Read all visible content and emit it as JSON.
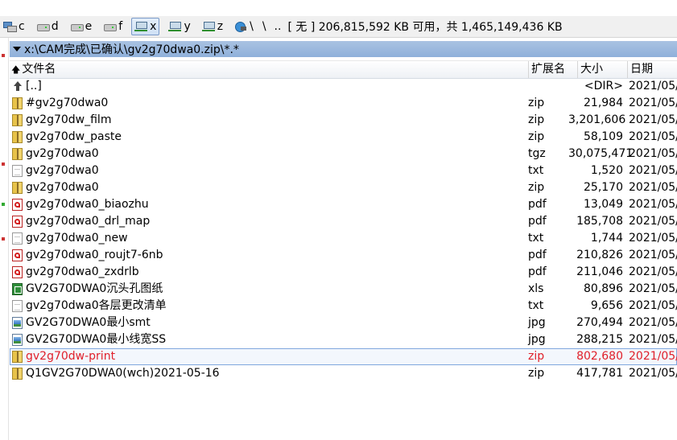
{
  "drivebar": {
    "drives": [
      {
        "label": "c",
        "icon": "system-drive-icon",
        "active": false
      },
      {
        "label": "d",
        "icon": "hard-drive-icon",
        "active": false
      },
      {
        "label": "e",
        "icon": "hard-drive-icon",
        "active": false
      },
      {
        "label": "f",
        "icon": "hard-drive-icon",
        "active": false
      },
      {
        "label": "x",
        "icon": "network-drive-icon",
        "active": true
      },
      {
        "label": "y",
        "icon": "network-drive-icon",
        "active": false
      },
      {
        "label": "z",
        "icon": "network-drive-icon",
        "active": false
      },
      {
        "label": "\\",
        "icon": "network-globe-icon",
        "active": false
      }
    ],
    "root": "\\",
    "up": "..",
    "info": "[ 无 ]  206,815,592 KB 可用，共 1,465,149,436 KB"
  },
  "path": "x:\\CAM完成\\已确认\\gv2g70dwa0.zip\\*.*",
  "header": {
    "name": "文件名",
    "ext": "扩展名",
    "size": "大小",
    "date": "日期"
  },
  "files": [
    {
      "icon": "parent-dir-icon",
      "name": "[..]",
      "ext": "",
      "size": "<DIR>",
      "date": "2021/05/"
    },
    {
      "icon": "zip",
      "name": "#gv2g70dwa0",
      "ext": "zip",
      "size": "21,984",
      "date": "2021/05/"
    },
    {
      "icon": "zip",
      "name": "gv2g70dw_film",
      "ext": "zip",
      "size": "3,201,606",
      "date": "2021/05/"
    },
    {
      "icon": "zip",
      "name": "gv2g70dw_paste",
      "ext": "zip",
      "size": "58,109",
      "date": "2021/05/"
    },
    {
      "icon": "zip",
      "name": "gv2g70dwa0",
      "ext": "tgz",
      "size": "30,075,471",
      "date": "2021/05/"
    },
    {
      "icon": "txt",
      "name": "gv2g70dwa0",
      "ext": "txt",
      "size": "1,520",
      "date": "2021/05/"
    },
    {
      "icon": "zip",
      "name": "gv2g70dwa0",
      "ext": "zip",
      "size": "25,170",
      "date": "2021/05/"
    },
    {
      "icon": "pdf",
      "name": "gv2g70dwa0_biaozhu",
      "ext": "pdf",
      "size": "13,049",
      "date": "2021/05/"
    },
    {
      "icon": "pdf",
      "name": "gv2g70dwa0_drl_map",
      "ext": "pdf",
      "size": "185,708",
      "date": "2021/05/"
    },
    {
      "icon": "txt",
      "name": "gv2g70dwa0_new",
      "ext": "txt",
      "size": "1,744",
      "date": "2021/05/"
    },
    {
      "icon": "pdf",
      "name": "gv2g70dwa0_roujt7-6nb",
      "ext": "pdf",
      "size": "210,826",
      "date": "2021/05/"
    },
    {
      "icon": "pdf",
      "name": "gv2g70dwa0_zxdrlb",
      "ext": "pdf",
      "size": "211,046",
      "date": "2021/05/"
    },
    {
      "icon": "xls",
      "name": "GV2G70DWA0沉头孔图纸",
      "ext": "xls",
      "size": "80,896",
      "date": "2021/05/"
    },
    {
      "icon": "txt",
      "name": "gv2g70dwa0各层更改清单",
      "ext": "txt",
      "size": "9,656",
      "date": "2021/05/"
    },
    {
      "icon": "jpg",
      "name": "GV2G70DWA0最小smt",
      "ext": "jpg",
      "size": "270,494",
      "date": "2021/05/"
    },
    {
      "icon": "jpg",
      "name": "GV2G70DWA0最小线宽SS",
      "ext": "jpg",
      "size": "288,215",
      "date": "2021/05/"
    },
    {
      "icon": "zip",
      "name": "gv2g70dw-print",
      "ext": "zip",
      "size": "802,680",
      "date": "2021/05/",
      "cursor": true
    },
    {
      "icon": "zip",
      "name": "Q1GV2G70DWA0(wch)2021-05-16",
      "ext": "zip",
      "size": "417,781",
      "date": "2021/05/"
    }
  ],
  "colors": {
    "cursor_text": "#e0202a",
    "path_bar": "#9db9df",
    "cursor_border": "#7fa7de"
  }
}
